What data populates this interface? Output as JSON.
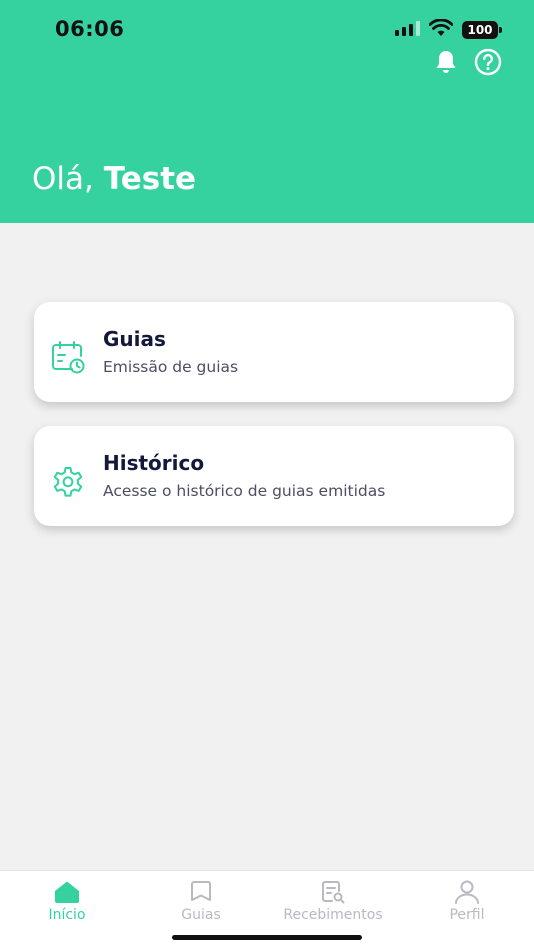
{
  "status_bar": {
    "time": "06:06",
    "battery": "100"
  },
  "header": {
    "greeting_prefix": "Olá,",
    "user_name": "Teste",
    "bell_icon": "bell-icon",
    "help_icon": "help-circle-icon"
  },
  "cards": [
    {
      "title": "Guias",
      "subtitle": "Emissão de guias",
      "icon": "calendar-clock-icon"
    },
    {
      "title": "Histórico",
      "subtitle": "Acesse o histórico de guias emitidas",
      "icon": "gear-icon"
    }
  ],
  "bottom_nav": {
    "items": [
      {
        "label": "Início",
        "icon": "home-icon",
        "active": true
      },
      {
        "label": "Guias",
        "icon": "bookmark-icon",
        "active": false
      },
      {
        "label": "Recebimentos",
        "icon": "receipt-search-icon",
        "active": false
      },
      {
        "label": "Perfil",
        "icon": "user-icon",
        "active": false
      }
    ]
  },
  "colors": {
    "accent": "#35d19f",
    "background": "#f1f1f1",
    "card_title": "#14183a",
    "nav_inactive": "#b9b9c2"
  }
}
